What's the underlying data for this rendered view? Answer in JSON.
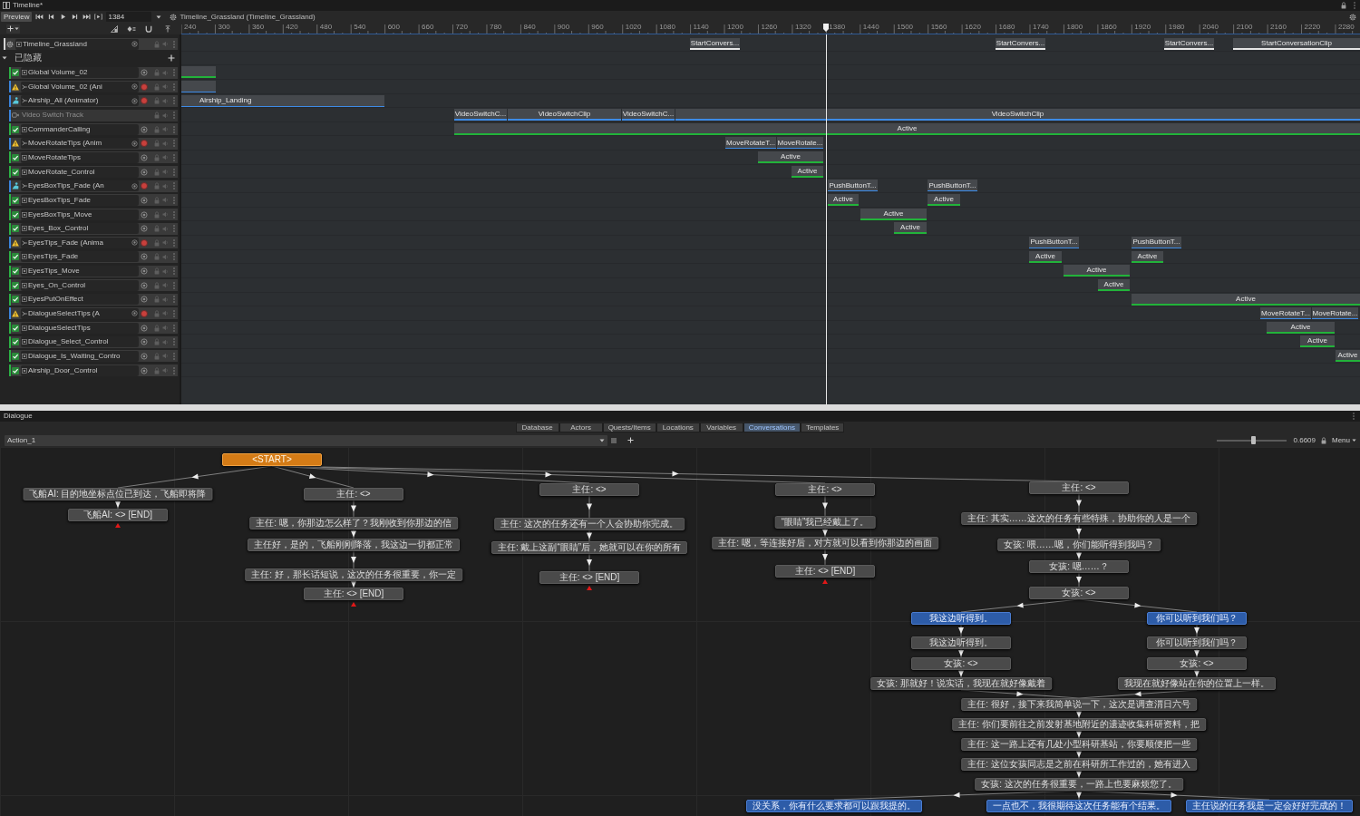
{
  "timeline": {
    "title": "Timeline*",
    "toolbar": {
      "preview": "Preview",
      "frame": "1384",
      "asset": "Timeline_Grassland (Timeline_Grassland)"
    },
    "ruler_labels": [
      "240",
      "300",
      "360",
      "420",
      "480",
      "540",
      "600",
      "660",
      "720",
      "780",
      "840",
      "900",
      "960",
      "1020",
      "1080",
      "1140",
      "1200",
      "1260",
      "1320",
      "1380",
      "1440",
      "1500",
      "1560",
      "1620",
      "1680",
      "1740",
      "1800",
      "1860",
      "1920",
      "1980",
      "2040",
      "2100",
      "2160",
      "2220",
      "2280"
    ],
    "tracks": [
      {
        "kind": "conversation",
        "name": "Timeline_Grassland",
        "clips": [
          {
            "label": "StartConvers..."
          },
          {
            "label": "StartConvers..."
          },
          {
            "label": "StartConvers..."
          },
          {
            "label": "StartConversationClip"
          }
        ]
      },
      {
        "kind": "group",
        "name": "已隐藏",
        "expanded": true
      },
      {
        "kind": "activation",
        "name": "Global Volume_02",
        "clips": [
          {
            "kind": "blank"
          }
        ]
      },
      {
        "kind": "animation",
        "name": "Global Volume_02 (Ani",
        "warning": true,
        "clips": [
          {
            "kind": "blank"
          }
        ]
      },
      {
        "kind": "animation",
        "name": "Airship_All (Animator)",
        "warning": false,
        "clips": [
          {
            "label": "Airship_Landing"
          }
        ]
      },
      {
        "kind": "video",
        "name": "Video Switch Track",
        "clips": [
          {
            "label": "VideoSwitchC..."
          },
          {
            "label": "VideoSwitchClip"
          },
          {
            "label": "VideoSwitchC..."
          },
          {
            "label": "VideoSwitchClip"
          }
        ]
      },
      {
        "kind": "activation",
        "name": "CommanderCalling",
        "clips": [
          {
            "label": "Active"
          }
        ]
      },
      {
        "kind": "animation",
        "name": "MoveRotateTips (Anim",
        "warning": true,
        "clips": [
          {
            "label": "MoveRotateT..."
          },
          {
            "label": "MoveRotate..."
          }
        ]
      },
      {
        "kind": "activation",
        "name": "MoveRotateTips",
        "clips": [
          {
            "label": "Active"
          }
        ]
      },
      {
        "kind": "activation",
        "name": "MoveRotate_Control",
        "clips": [
          {
            "label": "Active"
          }
        ]
      },
      {
        "kind": "animation",
        "name": "EyesBoxTips_Fade (An",
        "warning": false,
        "clips": [
          {
            "label": "PushButtonT..."
          },
          {
            "label": "PushButtonT..."
          }
        ]
      },
      {
        "kind": "activation",
        "name": "EyesBoxTips_Fade",
        "clips": [
          {
            "label": "Active"
          },
          {
            "label": "Active"
          }
        ]
      },
      {
        "kind": "activation",
        "name": "EyesBoxTips_Move",
        "clips": [
          {
            "label": "Active"
          }
        ]
      },
      {
        "kind": "activation",
        "name": "Eyes_Box_Control",
        "clips": [
          {
            "label": "Active"
          }
        ]
      },
      {
        "kind": "animation",
        "name": "EyesTips_Fade (Anima",
        "warning": true,
        "clips": [
          {
            "label": "PushButtonT..."
          },
          {
            "label": "PushButtonT..."
          }
        ]
      },
      {
        "kind": "activation",
        "name": "EyesTips_Fade",
        "clips": [
          {
            "label": "Active"
          },
          {
            "label": "Active"
          }
        ]
      },
      {
        "kind": "activation",
        "name": "EyesTips_Move",
        "clips": [
          {
            "label": "Active"
          }
        ]
      },
      {
        "kind": "activation",
        "name": "Eyes_On_Control",
        "clips": [
          {
            "label": "Active"
          }
        ]
      },
      {
        "kind": "activation",
        "name": "EyesPutOnEffect",
        "clips": [
          {
            "label": "Active"
          }
        ]
      },
      {
        "kind": "animation",
        "name": "DialogueSelectTips (A",
        "warning": true,
        "clips": [
          {
            "label": "MoveRotateT..."
          },
          {
            "label": "MoveRotate..."
          }
        ]
      },
      {
        "kind": "activation",
        "name": "DialogueSelectTips",
        "clips": [
          {
            "label": "Active"
          }
        ]
      },
      {
        "kind": "activation",
        "name": "Dialogue_Select_Control",
        "clips": [
          {
            "label": "Active"
          }
        ]
      },
      {
        "kind": "activation",
        "name": "Dialogue_Is_Waiting_Contro",
        "clips": [
          {
            "label": "Active"
          }
        ]
      },
      {
        "kind": "activation",
        "name": "Airship_Door_Control"
      }
    ]
  },
  "dialogue": {
    "title": "Dialogue",
    "tabs": [
      {
        "label": "Database",
        "selected": false
      },
      {
        "label": "Actors",
        "selected": false
      },
      {
        "label": "Quests/Items",
        "selected": false
      },
      {
        "label": "Locations",
        "selected": false
      },
      {
        "label": "Variables",
        "selected": false
      },
      {
        "label": "Conversations",
        "selected": true
      },
      {
        "label": "Templates",
        "selected": false
      }
    ],
    "conversation": "Action_1",
    "zoom": {
      "level": 0.53,
      "reading": "0.6609"
    },
    "menu": "Menu",
    "nodes": [
      {
        "kind": "start",
        "text": "<START>"
      },
      {
        "kind": "npc",
        "text": "飞船AI: 目的地坐标点位已到达，飞船即将降"
      },
      {
        "kind": "end",
        "text": "飞船AI: <> [END]"
      },
      {
        "kind": "npc",
        "text": "主任: <>"
      },
      {
        "kind": "npc",
        "text": "主任: 嗯，你那边怎么样了？我刚收到你那边的信"
      },
      {
        "kind": "npc",
        "text": "主任好，是的，飞船刚刚降落，我这边一切都正常"
      },
      {
        "kind": "npc",
        "text": "主任: 好，那长话短说，这次的任务很重要，你一定"
      },
      {
        "kind": "end",
        "text": "主任: <> [END]"
      },
      {
        "kind": "npc",
        "text": "主任: <>"
      },
      {
        "kind": "npc",
        "text": "主任: 这次的任务还有一个人会协助你完成。"
      },
      {
        "kind": "npc",
        "text": "主任: 戴上这副“眼睛”后，她就可以在你的所有"
      },
      {
        "kind": "end",
        "text": "主任: <> [END]"
      },
      {
        "kind": "npc",
        "text": "主任: <>"
      },
      {
        "kind": "npc",
        "text": "“眼睛”我已经戴上了。"
      },
      {
        "kind": "npc",
        "text": "主任: 嗯，等连接好后，对方就可以看到你那边的画面"
      },
      {
        "kind": "end",
        "text": "主任: <> [END]"
      },
      {
        "kind": "npc",
        "text": "主任: <>"
      },
      {
        "kind": "npc",
        "text": "主任: 其实……这次的任务有些特殊，协助你的人是一个"
      },
      {
        "kind": "npc",
        "text": "女孩: 喂……嗯，你们能听得到我吗？"
      },
      {
        "kind": "npc",
        "text": "女孩: 嗯……？"
      },
      {
        "kind": "npc",
        "text": "女孩: <>"
      },
      {
        "kind": "player",
        "text": "我这边听得到。"
      },
      {
        "kind": "player",
        "text": "你可以听到我们吗？"
      },
      {
        "kind": "npc",
        "text": "我这边听得到。"
      },
      {
        "kind": "npc",
        "text": "你可以听到我们吗？"
      },
      {
        "kind": "npc",
        "text": "女孩: <>"
      },
      {
        "kind": "npc",
        "text": "女孩: <>"
      },
      {
        "kind": "npc",
        "text": "女孩: 那就好！说实话，我现在就好像戴着"
      },
      {
        "kind": "npc",
        "text": "我现在就好像站在你的位置上一样。"
      },
      {
        "kind": "npc",
        "text": "主任: 很好，接下来我简单说一下，这次是调查渭日六号"
      },
      {
        "kind": "npc",
        "text": "主任: 你们要前往之前发射基地附近的遗迹收集科研资料，把"
      },
      {
        "kind": "npc",
        "text": "主任: 这一路上还有几处小型科研基站，你要顺便把一些"
      },
      {
        "kind": "npc",
        "text": "主任: 这位女孩同志是之前在科研所工作过的，她有进入"
      },
      {
        "kind": "npc",
        "text": "女孩: 这次的任务很重要，一路上也要麻烦您了。"
      },
      {
        "kind": "player",
        "text": "没关系，你有什么要求都可以跟我提的。"
      },
      {
        "kind": "player",
        "text": "一点也不，我很期待这次任务能有个结果。"
      },
      {
        "kind": "player",
        "text": "主任说的任务我是一定会好好完成的！"
      }
    ]
  }
}
